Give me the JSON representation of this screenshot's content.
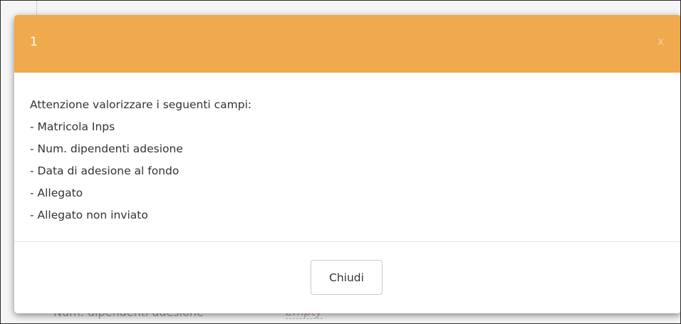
{
  "background": {
    "row_label": "Num. dipendenti adesione",
    "row_value": "Empty"
  },
  "modal": {
    "title": "1",
    "close_label": "x",
    "header_color": "#efaa4d",
    "message_lines": [
      "Attenzione valorizzare i seguenti campi:",
      "- Matricola Inps",
      "- Num. dipendenti adesione",
      "- Data di adesione al fondo",
      "- Allegato",
      "- Allegato non inviato"
    ],
    "close_button_label": "Chiudi"
  }
}
